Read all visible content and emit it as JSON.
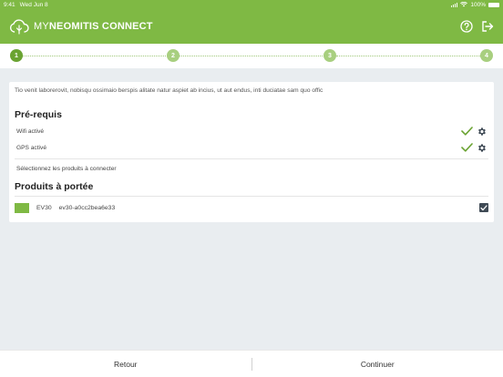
{
  "status_bar": {
    "time": "9:41",
    "date": "Wed Jun 8",
    "battery": "100%"
  },
  "header": {
    "brand_my": "MY",
    "brand_rest": "NEOMITIS CONNECT"
  },
  "stepper": {
    "steps": [
      "1",
      "2",
      "3",
      "4"
    ],
    "active_step": 1
  },
  "card": {
    "intro": "Tio venit laborerovit, nobisqu ossimaio berspis alitate natur aspiet ab incius, ut aut endus, inti duciatae sam quo offic",
    "prereq_title": "Pré-requis",
    "prereqs": [
      {
        "label": "Wifi activé"
      },
      {
        "label": "GPS activé"
      }
    ],
    "select_hint": "Sélectionnez les produits à connecter",
    "products_title": "Produits à portée",
    "products": [
      {
        "type": "EV30",
        "id": "ev30-a0cc2bea6e33",
        "checked": true,
        "color": "#7fb944"
      }
    ]
  },
  "footer": {
    "back_label": "Retour",
    "continue_label": "Continuer"
  },
  "colors": {
    "brand_green": "#7fb944",
    "check_green": "#6aa332",
    "dark_icon": "#3f4a55"
  }
}
